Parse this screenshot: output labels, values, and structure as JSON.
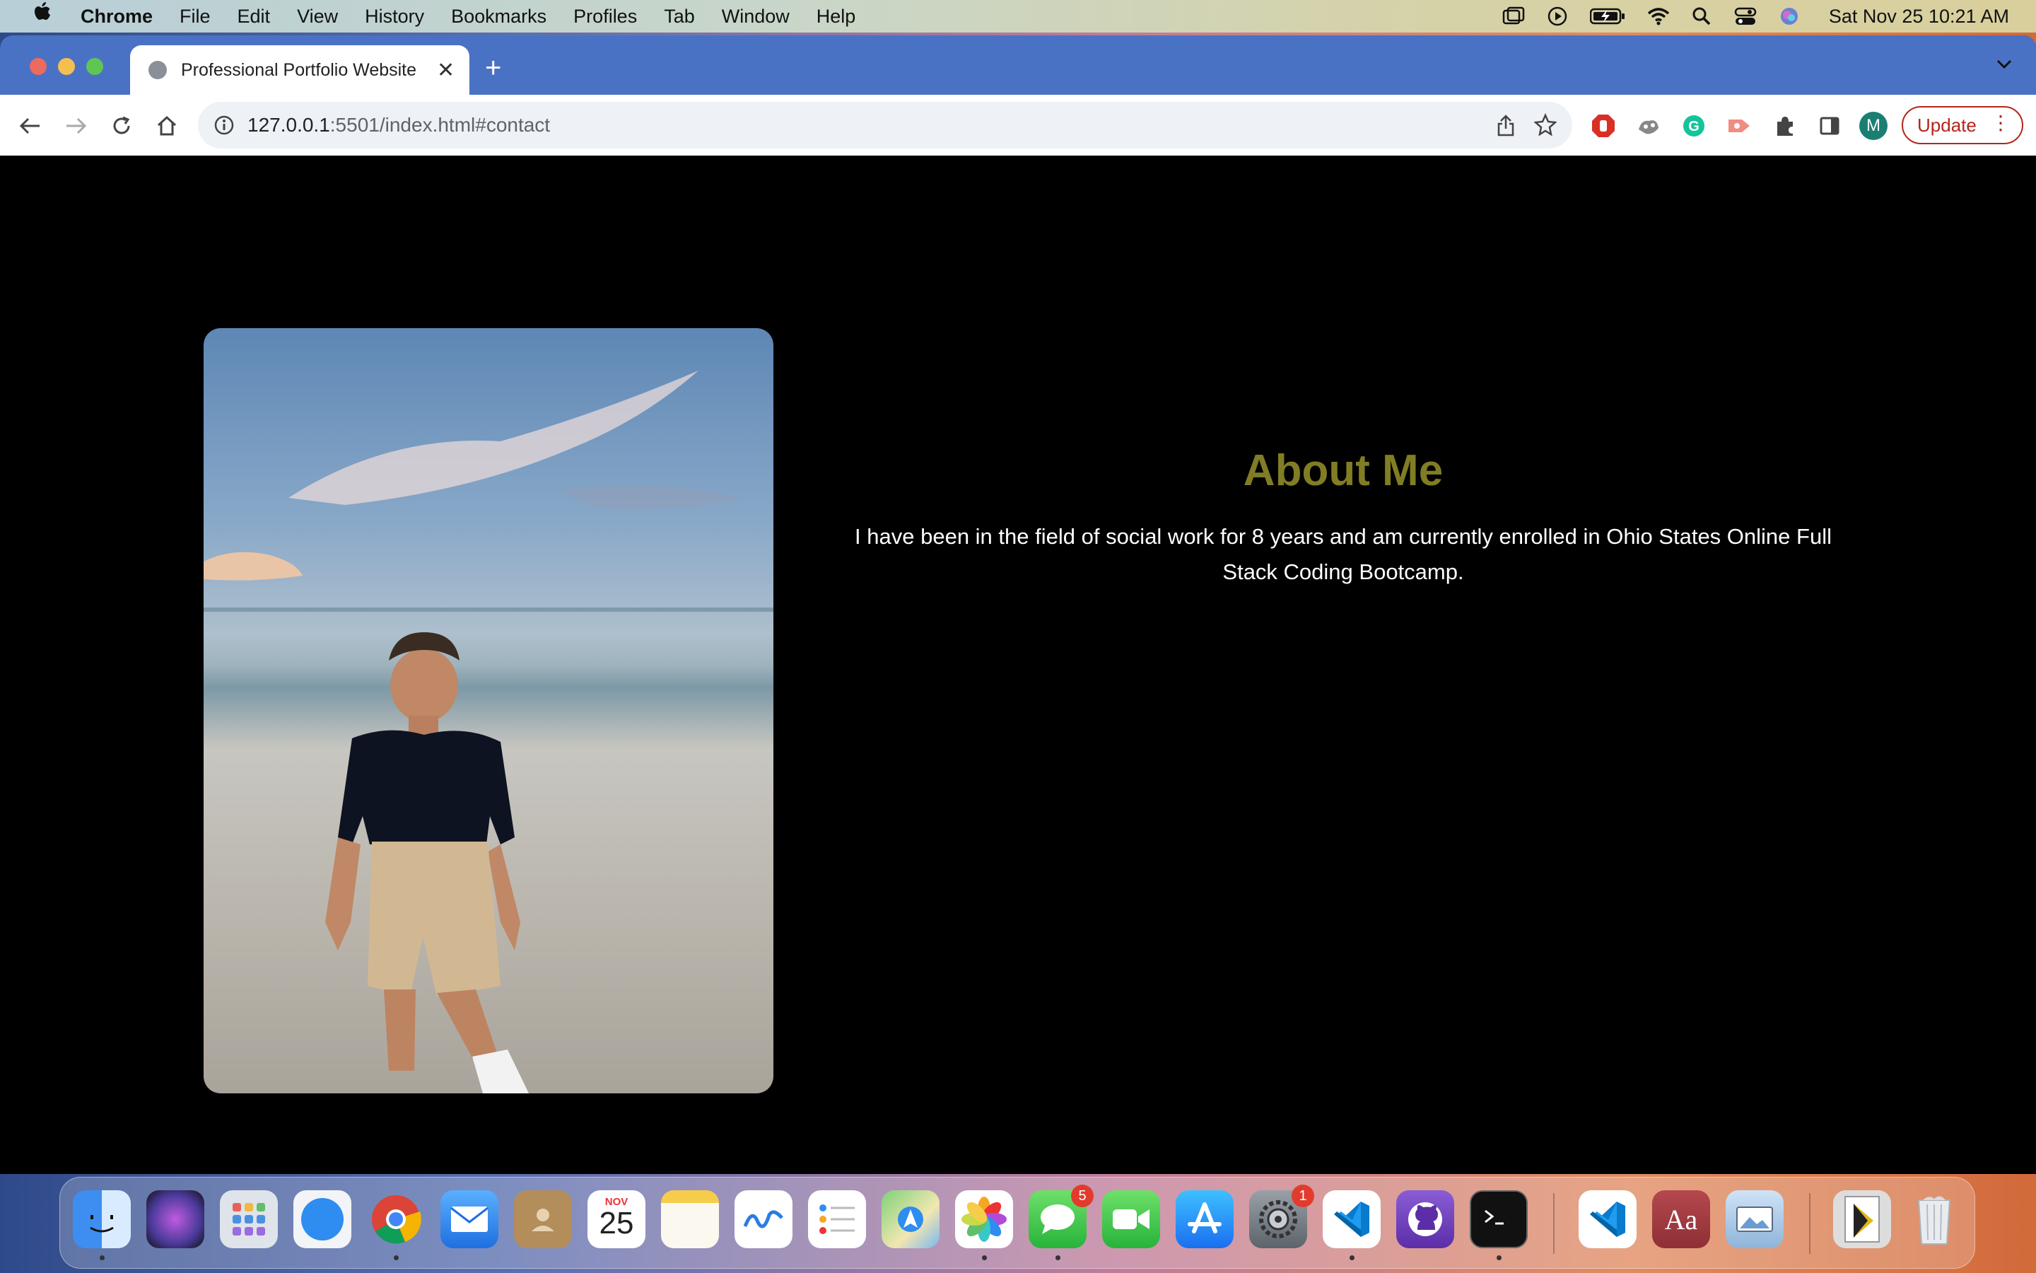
{
  "menubar": {
    "app_name": "Chrome",
    "items": [
      "File",
      "Edit",
      "View",
      "History",
      "Bookmarks",
      "Profiles",
      "Tab",
      "Window",
      "Help"
    ],
    "clock": "Sat Nov 25  10:21 AM"
  },
  "browser": {
    "tab_title": "Professional Portfolio Website",
    "url_host": "127.0.0.1",
    "url_path": ":5501/index.html#contact",
    "profile_initial": "M",
    "update_label": "Update"
  },
  "page": {
    "about_heading": "About Me",
    "about_text": "I have been in the field of social work for 8 years and am currently enrolled in Ohio States Online Full Stack Coding Bootcamp.",
    "heading_color": "#807d24"
  },
  "dock": {
    "calendar_month": "NOV",
    "calendar_day": "25",
    "messages_badge": "5",
    "settings_badge": "1",
    "dictionary_label": "Aa"
  }
}
